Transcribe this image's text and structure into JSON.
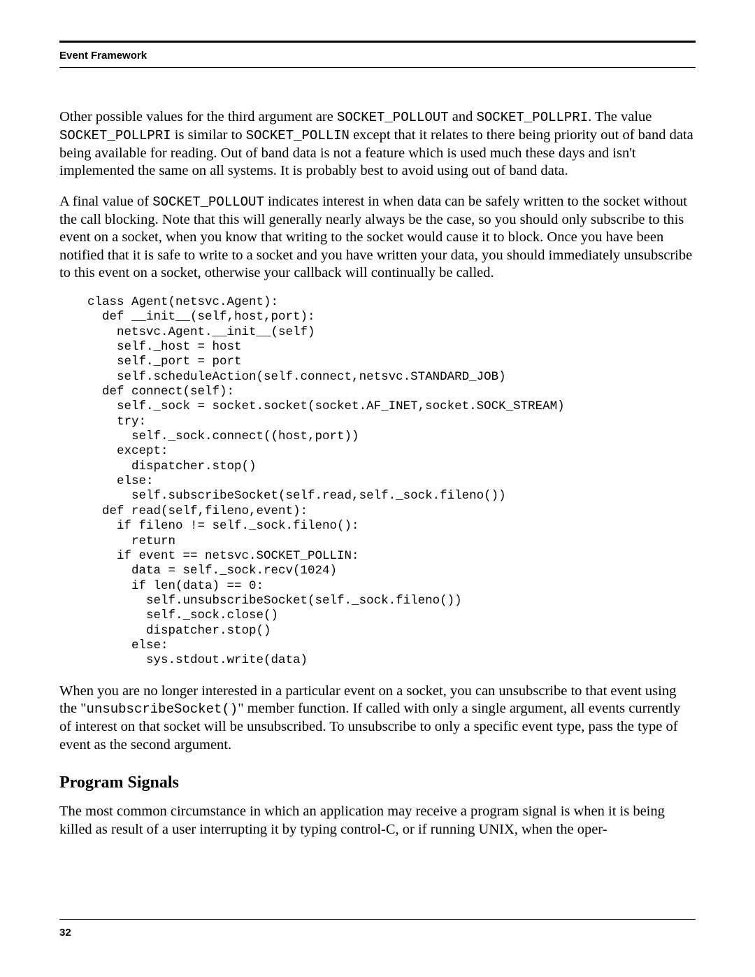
{
  "header": {
    "running_head": "Event Framework"
  },
  "paragraphs": {
    "p1_a": "Other possible values for the third argument are ",
    "p1_code1": "SOCKET_POLLOUT",
    "p1_b": " and ",
    "p1_code2": "SOCKET_POLLPRI",
    "p1_c": ". The value ",
    "p1_code3": "SOCKET_POLLPRI",
    "p1_d": " is similar to ",
    "p1_code4": "SOCKET_POLLIN",
    "p1_e": " except that it relates to there being priority out of band data being available for reading. Out of band data is not a feature which is used much these days and isn't implemented the same on all systems. It is probably best to avoid using out of band data.",
    "p2_a": "A final value of ",
    "p2_code1": "SOCKET_POLLOUT",
    "p2_b": " indicates interest in when data can be safely written to the socket without the call blocking. Note that this will generally nearly always be the case, so you should only subscribe to this event on a socket, when you know that writing to the socket would cause it to block. Once you have been notified that it is safe to write to a socket and you have written your data, you should immediately unsubscribe to this event on a socket, otherwise your callback will continually be called.",
    "p3_a": "When you are no longer interested in a particular event on a socket, you can unsubscribe to that event using the \"",
    "p3_code1": "unsubscribeSocket()",
    "p3_b": "\" member function. If called with only a single argument, all events currently of interest on that socket will be unsubscribed. To unsubscribe to only a specific event type, pass the type of event as the second argument.",
    "p4": "The most common circumstance in which an application may receive a program signal is when it is being killed as result of a user interrupting it by typing control-C, or if running UNIX, when the oper-"
  },
  "code_block": "class Agent(netsvc.Agent):\n  def __init__(self,host,port):\n    netsvc.Agent.__init__(self)\n    self._host = host\n    self._port = port\n    self.scheduleAction(self.connect,netsvc.STANDARD_JOB)\n  def connect(self):\n    self._sock = socket.socket(socket.AF_INET,socket.SOCK_STREAM)\n    try:\n      self._sock.connect((host,port))\n    except:\n      dispatcher.stop()\n    else:\n      self.subscribeSocket(self.read,self._sock.fileno())\n  def read(self,fileno,event):\n    if fileno != self._sock.fileno():\n      return\n    if event == netsvc.SOCKET_POLLIN:\n      data = self._sock.recv(1024)\n      if len(data) == 0:\n        self.unsubscribeSocket(self._sock.fileno())\n        self._sock.close()\n        dispatcher.stop()\n      else:\n        sys.stdout.write(data)",
  "section_heading": "Program Signals",
  "footer": {
    "page_number": "32"
  }
}
